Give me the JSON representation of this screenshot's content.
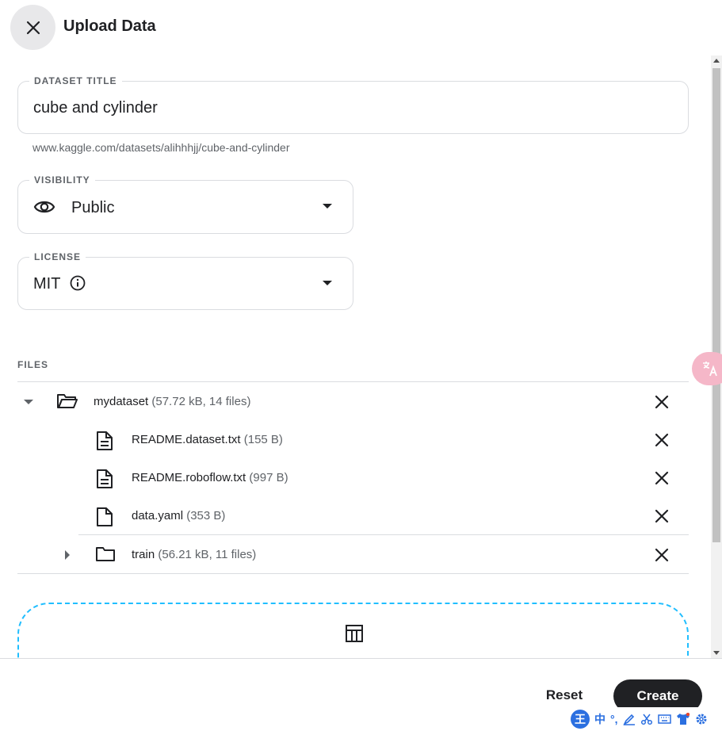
{
  "header": {
    "title": "Upload Data"
  },
  "dataset_title": {
    "label": "DATASET TITLE",
    "value": "cube and cylinder",
    "url": "www.kaggle.com/datasets/alihhhjj/cube-and-cylinder"
  },
  "visibility": {
    "label": "VISIBILITY",
    "value": "Public"
  },
  "license": {
    "label": "LICENSE",
    "value": "MIT"
  },
  "files": {
    "label": "FILES",
    "rows": [
      {
        "name": "mydataset",
        "meta": "(57.72 kB, 14 files)",
        "icon": "folder-open-icon"
      },
      {
        "name": "README.dataset.txt",
        "meta": "(155 B)",
        "icon": "document-icon"
      },
      {
        "name": "README.roboflow.txt",
        "meta": "(997 B)",
        "icon": "document-icon"
      },
      {
        "name": "data.yaml",
        "meta": "(353 B)",
        "icon": "file-icon"
      },
      {
        "name": "train",
        "meta": "(56.21 kB, 11 files)",
        "icon": "folder-icon"
      }
    ]
  },
  "footer": {
    "reset": "Reset",
    "create": "Create"
  },
  "ime": {
    "logo": "王",
    "items": [
      "中",
      "°,"
    ]
  },
  "colors": {
    "accent": "#20beff",
    "primary_dark": "#202124"
  }
}
